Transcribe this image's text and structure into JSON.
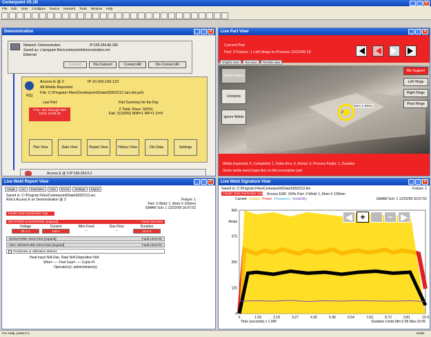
{
  "app": {
    "title": "Centerpoint V5.1R",
    "menu": [
      "File",
      "Edit",
      "View",
      "Configure",
      "Device",
      "Network",
      "Tools",
      "Window",
      "Help"
    ]
  },
  "toolbar": {
    "icons": [
      "new-icon",
      "open-icon",
      "save-icon",
      "print-icon",
      "grid-icon",
      "chart-icon",
      "left-icon",
      "left-icon",
      "left-icon",
      "right-icon",
      "right-icon",
      "right-icon",
      "right-icon",
      "zoom-icon",
      "zoom-icon",
      "list-icon",
      "window-icon",
      "window-icon",
      "help-icon",
      "weld-icon",
      "weld-icon",
      "down-icon",
      "down-icon",
      "up-icon",
      "up-icon",
      "up-icon",
      "up-icon",
      "up-icon",
      "save-icon",
      "disk-icon"
    ]
  },
  "demo": {
    "title": "Demonstration",
    "network": "Network: Demonstration",
    "ip": "IP:169.254.86.186",
    "saved": "Saved as: c:\\program files\\centerpoint\\demonstration.net",
    "ethernet": "Ethernet",
    "buttons": {
      "connect": "Connect",
      "disconnect": "Dis-Connect",
      "connect_all": "Connect All",
      "disconnect_all": "Dis-Connect All"
    },
    "device": {
      "name": "Access E @ 2",
      "ip": "IP:10.100.100.123",
      "reported": "All Welds Reported",
      "file": "File: C:\\Program Files\\Centerpoint\\Data\\S0D2212 (arc,bin,prt)",
      "r": "R[1]"
    },
    "last_part": {
      "label": "Last Part:",
      "status": "FAIL: Not Enough Wel",
      "time": "12/22 16:06:46"
    },
    "summary": {
      "label": "Part Summary for the Day",
      "line1": "2 Total, Pass: 0(0%)",
      "line2": "Fail: 2(100%) MW=1 WF=1 O=0"
    },
    "views": [
      "Part View",
      "Data View",
      "Report View",
      "History View",
      "File Data",
      "Settings"
    ],
    "device2": "Access E @ 3 IP:169.254.0.2"
  },
  "part": {
    "title": "Live Part View",
    "current": "Current Part",
    "detail": "Part: 2 Fixture: 1 Left Hinge In-Process 12/22/09 16",
    "tabs": [
      "Graphic view",
      "Text view",
      "Timeline view"
    ],
    "left_buttons": [
      "Select Fixture",
      "Unclamp",
      "Ignore Welds"
    ],
    "right_buttons": [
      "Bin Support",
      "Left Hinge",
      "Right Hinge",
      "Pivot Hinge"
    ],
    "weld_label": "8mm X 80mm",
    "weld_num": "2",
    "status1": "Welds Expected: 6, Completed: 1, False Arcs: 0, Extras: 0, Process Faults: 1, Duration",
    "status2": "Some welds need inspection on this incomplete part"
  },
  "report": {
    "title": "Live Weld Report View",
    "tabs": [
      "Single",
      "List",
      "Downtime",
      "Cost",
      "Errors",
      "Settings",
      "Export"
    ],
    "saved": "Saved in: C:\\Program Files\\Centerpoint\\Data\\S0D2212.arc",
    "device": "Rick's Access E on Demonstration @ 2",
    "fixture": "Fixture: 1",
    "part": "Part: 3 Weld: 1, 8mm X 100mm",
    "gmaw": "GMAW Sch: 1 12/22/09 16:07:52",
    "fault": "Faults: Over Dur/Under Cap",
    "setpoint": "SET-POINT & DURATION: [expand]",
    "setpoint_fault": "Fault Limit 20%",
    "cols": [
      "Voltage",
      "Current",
      "Wire Feed",
      "Gas Flow",
      "Duration"
    ],
    "vals": [
      "25.1 V",
      "148 A",
      "---",
      "---",
      "10.9 S"
    ],
    "sig": "SIGNATURE ANALYSIS [expand]",
    "sig_fault": "Fault Limit 0%",
    "adv": "ADV. SIGNATURE ANALYSIS [expand]",
    "adv_fault": "Fault Limit 0%",
    "prod": "Production & Utilization Metrics",
    "line1": "Heat Input N/A   Dep. Rate N/A   Deposition N/A",
    "line2": "Wire= ---- Feet   Gas= ---- Cubic-Ft",
    "line3": "Operator(s): administrator(s)"
  },
  "sig": {
    "title": "Live Weld Signature View",
    "saved": "Saved in: C:\\Program Files\\Centerpoint\\Data\\S0D2212.bin",
    "fixture": "Fixture: 1",
    "fault": "Faults: Over Dur/Under Cap",
    "access": "Access ESR: 1KHz Part: 3 Weld: 1, 8mm X 100mm",
    "legend": {
      "current": "Current",
      "voltage": "Voltage",
      "power": "Power",
      "frequency": "Frequency",
      "instability": "Instability"
    },
    "gmaw": "GMAW Sch: 1 12/22/09 16:07:52",
    "xlabel": "Time (seconds) x 1.000",
    "duration": "Duration Limits Min:2.05  Max:10.05"
  },
  "chart_data": {
    "type": "line",
    "ylabel": "Amps",
    "ylim": [
      0,
      500
    ],
    "yticks": [
      "500",
      "375",
      "250",
      "125",
      "0"
    ],
    "xticks": [
      "0",
      "1.09",
      "2.18",
      "3.27",
      "4.36",
      "5.45",
      "6.54",
      "7.63",
      "8.72",
      "9.81",
      "10.9"
    ],
    "xlim": [
      0,
      10.9
    ],
    "series": [
      {
        "name": "Current",
        "color": "#e02020",
        "x": [
          0,
          0.3,
          0.6,
          1,
          1.5,
          2,
          2.5,
          3,
          3.5,
          4,
          4.5,
          5,
          5.5,
          6,
          6.5,
          7,
          7.5,
          8,
          8.5,
          9,
          9.5,
          10,
          10.5,
          10.9
        ],
        "y": [
          0,
          310,
          300,
          290,
          305,
          295,
          310,
          300,
          290,
          305,
          295,
          300,
          310,
          290,
          300,
          305,
          295,
          300,
          310,
          295,
          305,
          300,
          290,
          120
        ]
      },
      {
        "name": "Voltage",
        "color": "#ffd800",
        "x": [
          0,
          0.3,
          1,
          2,
          3,
          4,
          5,
          6,
          7,
          8,
          9,
          10,
          10.9
        ],
        "y": [
          0,
          500,
          480,
          490,
          470,
          490,
          480,
          470,
          490,
          480,
          470,
          490,
          0
        ]
      },
      {
        "name": "Power",
        "color": "#000000",
        "x": [
          0,
          0.5,
          1,
          2,
          3,
          4,
          5,
          6,
          7,
          8,
          9,
          10,
          10.9
        ],
        "y": [
          0,
          195,
          200,
          190,
          205,
          195,
          200,
          190,
          200,
          205,
          195,
          200,
          40
        ]
      },
      {
        "name": "Instability",
        "color": "#7a4fb8",
        "x": [
          0,
          1,
          2,
          3,
          4,
          5,
          6,
          7,
          8,
          9,
          10,
          10.9
        ],
        "y": [
          60,
          62,
          60,
          64,
          58,
          62,
          60,
          63,
          61,
          60,
          62,
          58
        ]
      }
    ],
    "grid": false
  },
  "statusbar": {
    "help": "For Help, press F1",
    "num": "NUM"
  }
}
